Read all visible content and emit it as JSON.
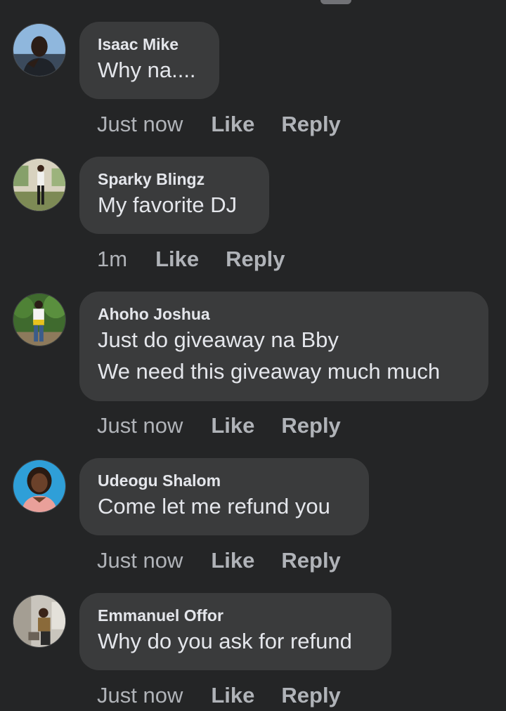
{
  "comments": [
    {
      "author": "Isaac Mike",
      "lines": [
        "Why na...."
      ],
      "time": "Just now",
      "like": "Like",
      "reply": "Reply",
      "avatar_icon": "user-avatar-photo"
    },
    {
      "author": "Sparky Blingz",
      "lines": [
        "My favorite DJ"
      ],
      "time": "1m",
      "like": "Like",
      "reply": "Reply",
      "avatar_icon": "user-avatar-photo"
    },
    {
      "author": "Ahoho Joshua",
      "lines": [
        "Just do giveaway na Bby",
        "We need this giveaway much much"
      ],
      "time": "Just now",
      "like": "Like",
      "reply": "Reply",
      "avatar_icon": "user-avatar-photo"
    },
    {
      "author": "Udeogu Shalom",
      "lines": [
        "Come let me refund you"
      ],
      "time": "Just now",
      "like": "Like",
      "reply": "Reply",
      "avatar_icon": "user-avatar-photo"
    },
    {
      "author": "Emmanuel Offor",
      "lines": [
        "Why do you ask for refund"
      ],
      "time": "Just now",
      "like": "Like",
      "reply": "Reply",
      "avatar_icon": "user-avatar-photo"
    }
  ],
  "colors": {
    "background": "#242526",
    "bubble": "#3a3b3c",
    "primary_text": "#e4e6eb",
    "secondary_text": "#b0b3b8"
  }
}
